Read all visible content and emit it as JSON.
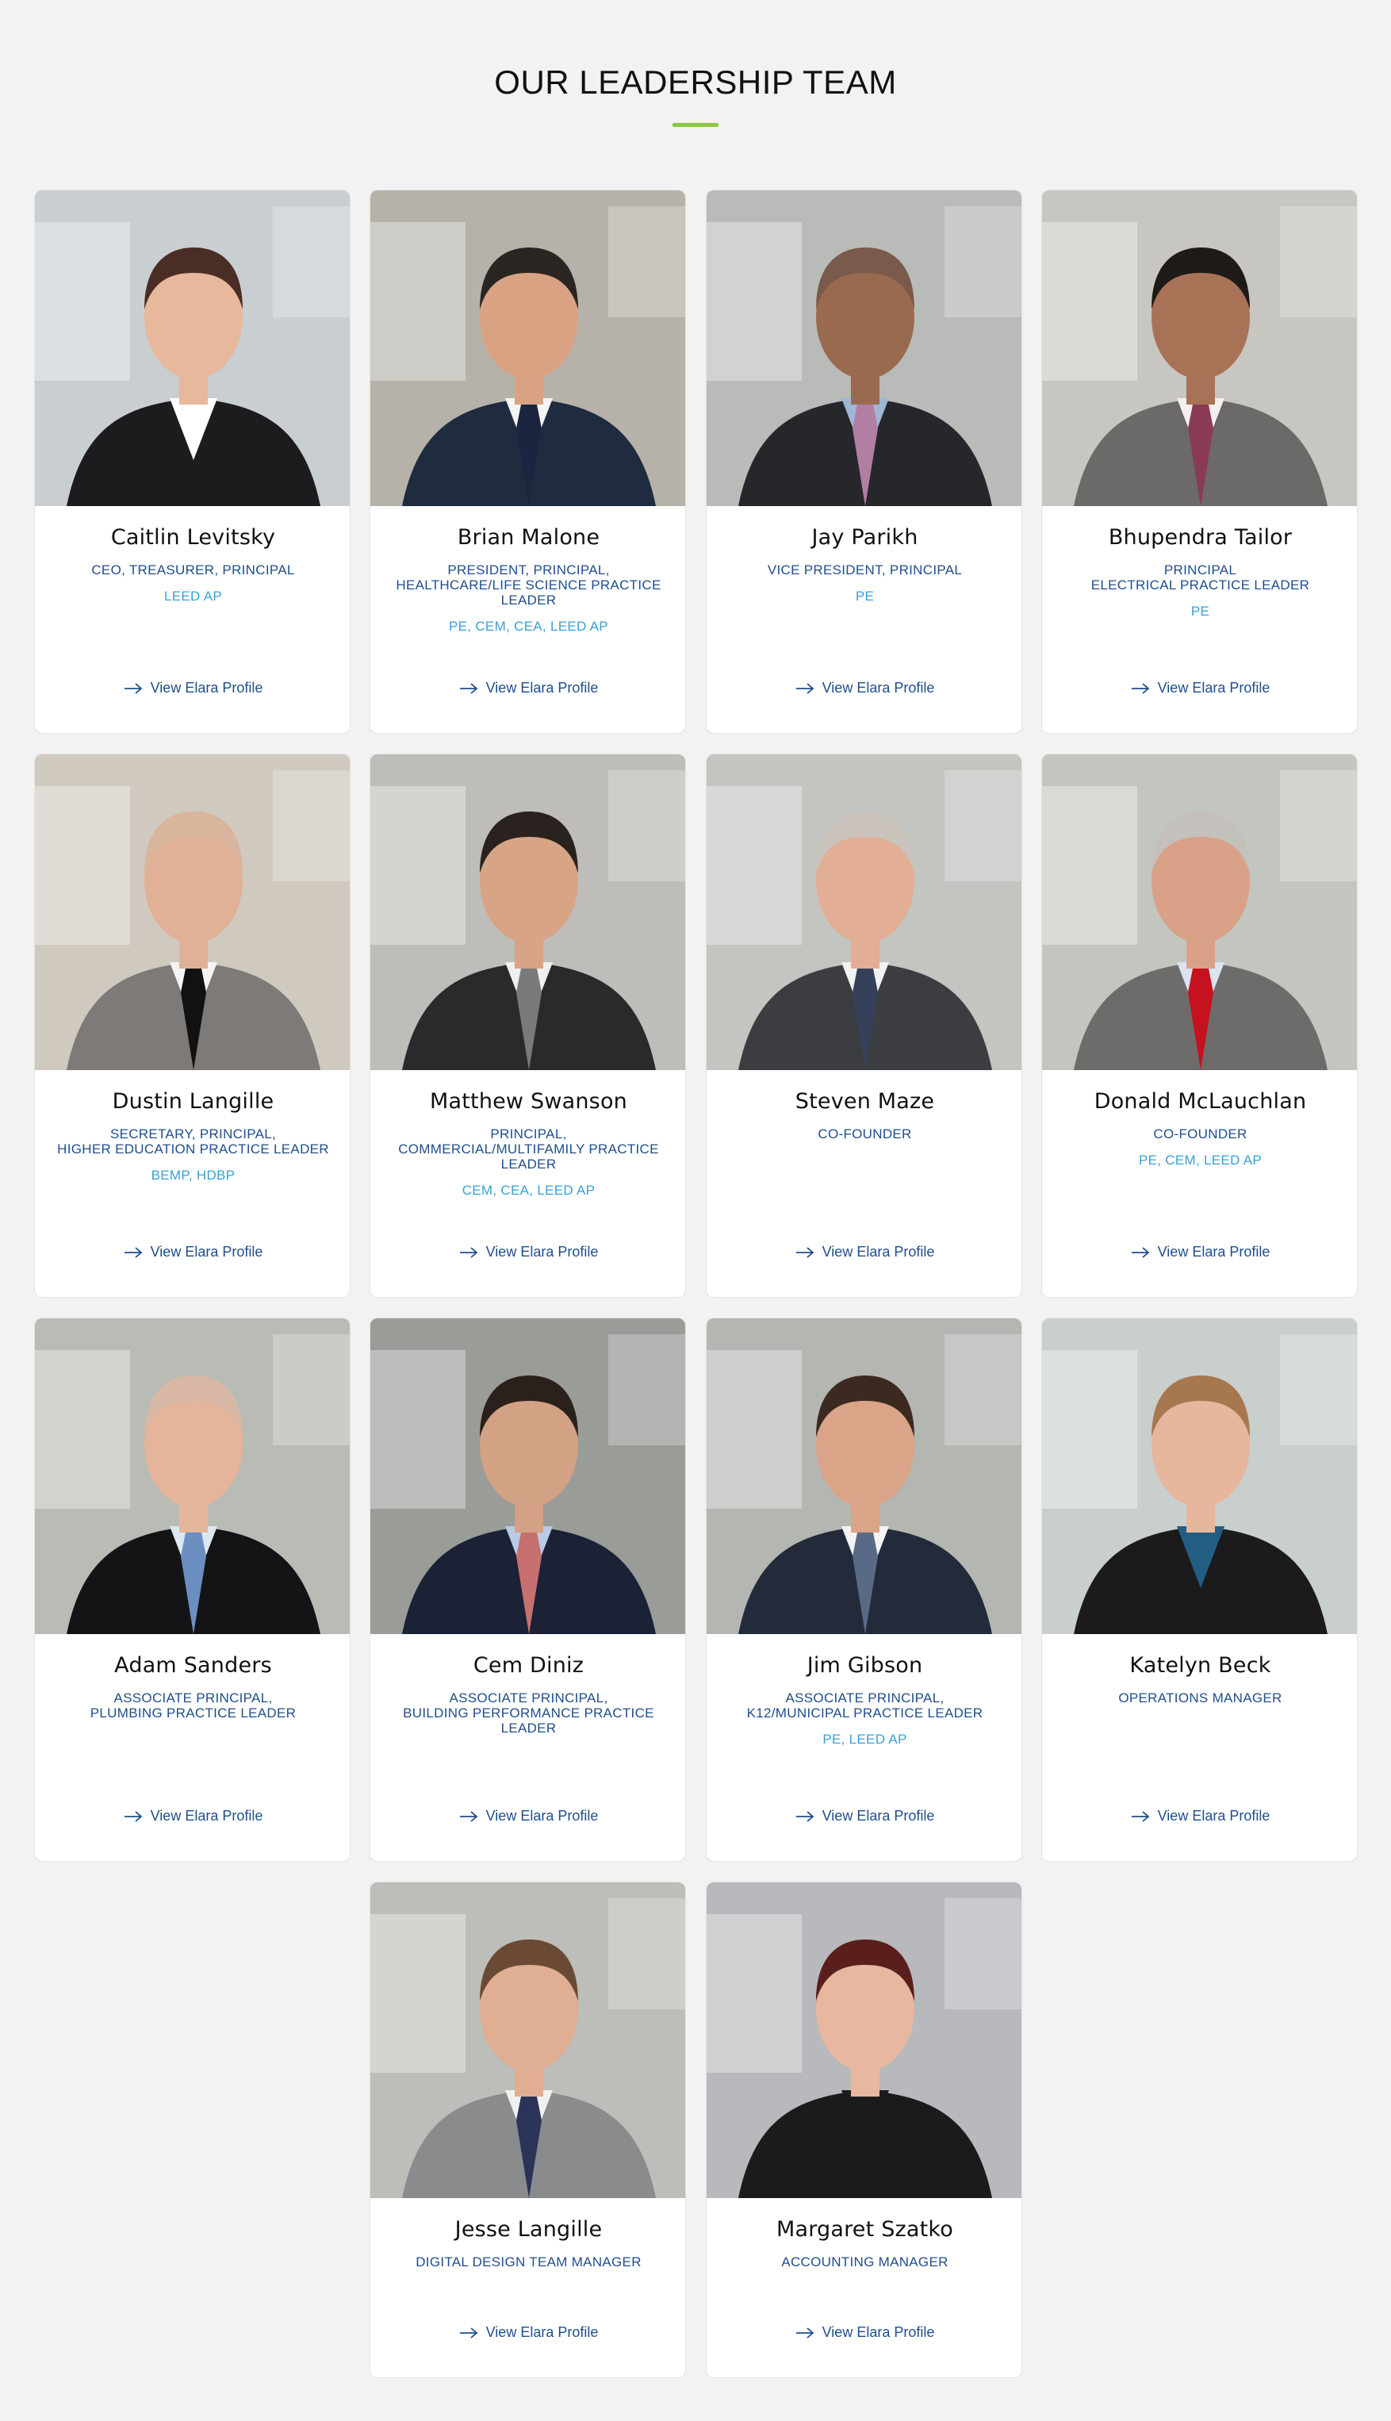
{
  "heading": "OUR LEADERSHIP TEAM",
  "colors": {
    "accent": "#8cc63f",
    "role": "#1f4e8c",
    "credentials": "#3aa0d6",
    "link": "#1f4e8c"
  },
  "link_icon": "arrow-right-icon",
  "members": [
    {
      "name": "Caitlin Levitsky",
      "role": "CEO, TREASURER, PRINCIPAL",
      "creds": "LEED AP",
      "link": "View Elara Profile"
    },
    {
      "name": "Brian Malone",
      "role": "PRESIDENT, PRINCIPAL, HEALTHCARE/LIFE SCIENCE PRACTICE LEADER",
      "creds": "PE, CEM, CEA, LEED AP",
      "link": "View Elara Profile"
    },
    {
      "name": "Jay Parikh",
      "role": "VICE PRESIDENT, PRINCIPAL",
      "creds": "PE",
      "link": "View Elara Profile"
    },
    {
      "name": "Bhupendra Tailor",
      "role": "PRINCIPAL\nELECTRICAL PRACTICE LEADER",
      "creds": "PE",
      "link": "View Elara Profile"
    },
    {
      "name": "Dustin Langille",
      "role": "SECRETARY, PRINCIPAL,\nHIGHER EDUCATION PRACTICE LEADER",
      "creds": "BEMP, HDBP",
      "link": "View Elara Profile"
    },
    {
      "name": "Matthew Swanson",
      "role": "PRINCIPAL,\nCOMMERCIAL/MULTIFAMILY PRACTICE LEADER",
      "creds": "CEM, CEA, LEED AP",
      "link": "View Elara Profile"
    },
    {
      "name": "Steven Maze",
      "role": "CO-FOUNDER",
      "creds": "",
      "link": "View Elara Profile"
    },
    {
      "name": "Donald McLauchlan",
      "role": "CO-FOUNDER",
      "creds": "PE, CEM, LEED AP",
      "link": "View Elara Profile"
    },
    {
      "name": "Adam Sanders",
      "role": "ASSOCIATE PRINCIPAL,\nPLUMBING PRACTICE LEADER",
      "creds": "",
      "link": "View Elara Profile"
    },
    {
      "name": "Cem Diniz",
      "role": "ASSOCIATE PRINCIPAL,\nBUILDING PERFORMANCE PRACTICE LEADER",
      "creds": "",
      "link": "View Elara Profile"
    },
    {
      "name": "Jim Gibson",
      "role": "ASSOCIATE PRINCIPAL,\nK12/MUNICIPAL PRACTICE LEADER",
      "creds": "PE, LEED AP",
      "link": "View Elara Profile"
    },
    {
      "name": "Katelyn Beck",
      "role": "OPERATIONS MANAGER",
      "creds": "",
      "link": "View Elara Profile"
    },
    {
      "name": "Jesse Langille",
      "role": "DIGITAL DESIGN TEAM MANAGER",
      "creds": "",
      "link": "View Elara Profile"
    },
    {
      "name": "Margaret Szatko",
      "role": "ACCOUNTING MANAGER",
      "creds": "",
      "link": "View Elara Profile"
    }
  ]
}
